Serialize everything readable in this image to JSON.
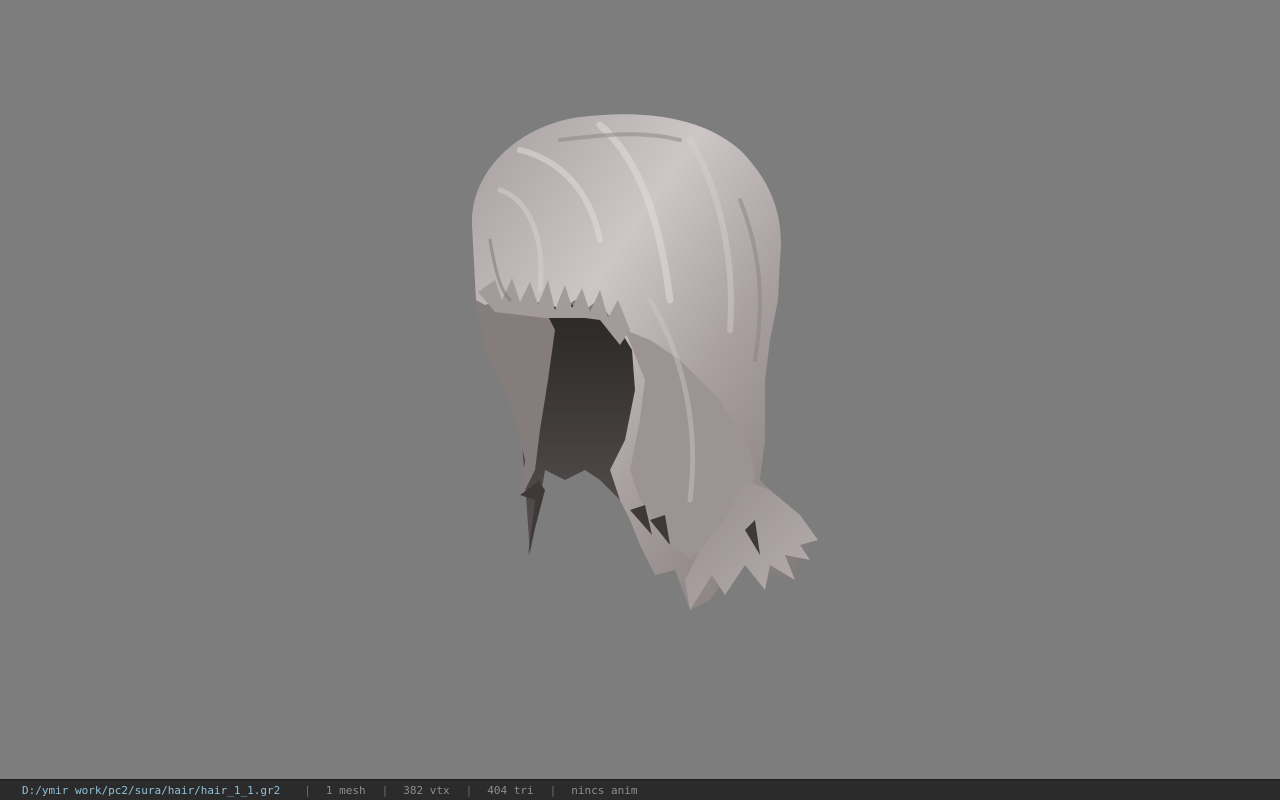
{
  "viewport": {
    "background": "#7d7d7d",
    "model_name": "hair mesh"
  },
  "status": {
    "path": "D:/ymir work/pc2/sura/hair/hair_1_1.gr2",
    "mesh": "1 mesh",
    "vertices": "382 vtx",
    "triangles": "404 tri",
    "anim": "nincs anim",
    "separator": "|"
  },
  "colors": {
    "statusbar_bg": "#2b2b2b",
    "path_text": "#8fbfd8",
    "info_text": "#8c8c8c",
    "hair_light": "#c9c2c2",
    "hair_mid": "#9a9191",
    "hair_dark": "#3a3535"
  }
}
